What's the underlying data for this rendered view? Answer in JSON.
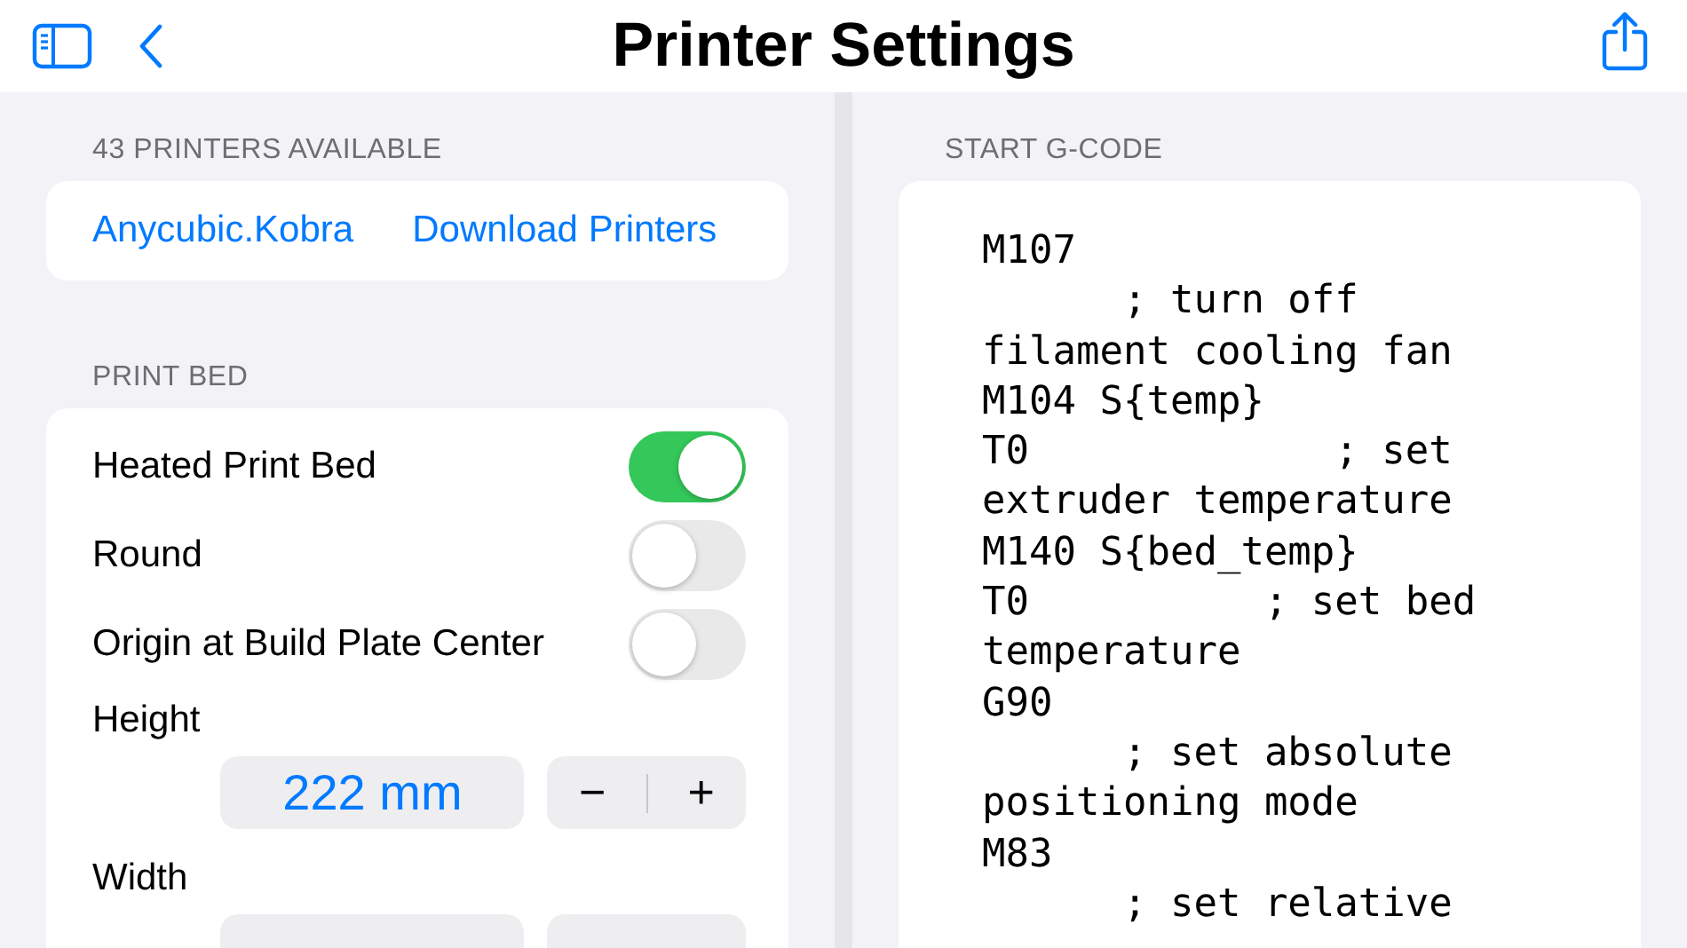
{
  "nav": {
    "title": "Printer Settings"
  },
  "printers": {
    "header": "43 PRINTERS AVAILABLE",
    "selected_printer": "Anycubic.Kobra",
    "download_link": "Download Printers"
  },
  "print_bed": {
    "header": "PRINT BED",
    "toggles": [
      {
        "label": "Heated Print Bed",
        "on": true
      },
      {
        "label": "Round",
        "on": false
      },
      {
        "label": "Origin at Build Plate Center",
        "on": false
      }
    ],
    "steppers": [
      {
        "label": "Height",
        "value": "222 mm",
        "minus": "−",
        "plus": "+"
      },
      {
        "label": "Width"
      }
    ]
  },
  "start_gcode": {
    "header": "START G-CODE",
    "lines": [
      "M107",
      "      ; turn off",
      "filament cooling fan",
      "M104 S{temp}",
      "T0             ; set",
      "extruder temperature",
      "M140 S{bed_temp}",
      "T0          ; set bed",
      "temperature",
      "G90",
      "      ; set absolute",
      "positioning mode",
      "M83",
      "      ; set relative"
    ]
  }
}
